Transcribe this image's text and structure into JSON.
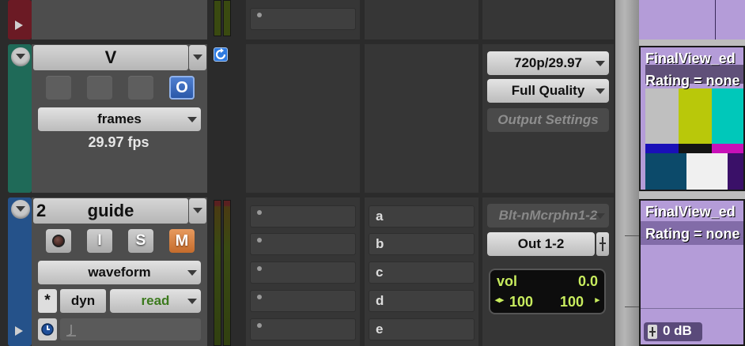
{
  "colors": {
    "track_red": "#6b1a24",
    "track_teal": "#1f6a58",
    "track_blue": "#25528a",
    "online_blue": "#2a58a8",
    "mute_orange": "#c56c2c",
    "vol_green": "#c8ec5e",
    "clip_purple": "#b49cd8"
  },
  "video_track": {
    "name": "V",
    "timebase": "frames",
    "frame_rate": "29.97 fps",
    "online_button": "O",
    "format": "720p/29.97",
    "quality": "Full Quality",
    "output_settings": "Output Settings"
  },
  "audio_track": {
    "number": "2",
    "name": "guide",
    "input_button": "I",
    "solo_button": "S",
    "mute_button": "M",
    "view": "waveform",
    "dyn_label": "dyn",
    "automation_mode": "read",
    "asterisk": "*",
    "sends": [
      "a",
      "b",
      "c",
      "d",
      "e"
    ],
    "input": "Blt-nMcrphn1-2",
    "output": "Out 1-2",
    "volume_label": "vol",
    "volume_value": "0.0",
    "pan_left": "100",
    "pan_right": "100"
  },
  "clips": {
    "video_clip_title": "FinalView_ed",
    "video_clip_rating": "Rating = none",
    "audio_clip_title": "FinalView_ed",
    "audio_clip_rating": "Rating = none",
    "audio_clip_gain": "0 dB"
  },
  "icons": {
    "expand": "triangle-right",
    "collapse": "chevron-down",
    "sync": "circular-arrow",
    "clock": "clock",
    "tempo": "metronome"
  }
}
